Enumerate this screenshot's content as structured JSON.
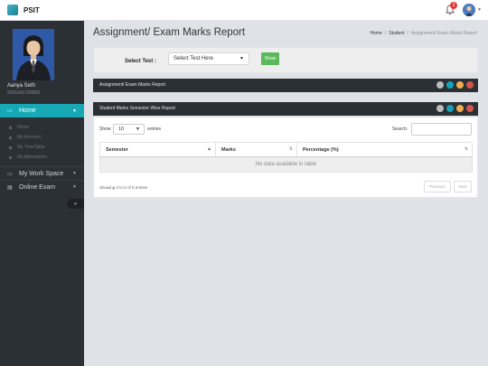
{
  "header": {
    "brand": "PSIT",
    "notification_count": "2"
  },
  "sidebar": {
    "user_name": "Aanya Seth",
    "user_id": "2201641720002",
    "home_label": "Home",
    "sub_items": [
      {
        "label": "Home"
      },
      {
        "label": "My Account"
      },
      {
        "label": "My TimeTable"
      },
      {
        "label": "My Attendance"
      }
    ],
    "work_space_label": "My Work Space",
    "online_exam_label": "Online Exam",
    "collapse_glyph": "«"
  },
  "page": {
    "title": "Assignment/ Exam Marks Report",
    "breadcrumb": [
      "Home",
      "Student",
      "Assignment/ Exam Marks Report"
    ]
  },
  "filter": {
    "label": "Select Test :",
    "select_value": "Select Test Here",
    "button_label": "Show"
  },
  "panels": {
    "assignment_title": "Assignment/ Exam Marks Report",
    "semester_title": "Student Marks Semester Wise Report"
  },
  "table": {
    "show_label": "Show",
    "length_value": "10",
    "entries_label": "entries",
    "search_label": "Search:",
    "columns": [
      "Semester",
      "Marks",
      "Percentage (%)"
    ],
    "empty_message": "No data available in table",
    "info": "Showing 0 to 0 of 0 entries",
    "prev_label": "Previous",
    "next_label": "Next"
  },
  "colors": {
    "accent": "#16a9b5",
    "sidebar": "#2b3034",
    "show_button": "#5cb85c",
    "panel_controls": [
      "#bdbdbd",
      "#17a2b8",
      "#f0ad4e",
      "#d9534f"
    ]
  }
}
